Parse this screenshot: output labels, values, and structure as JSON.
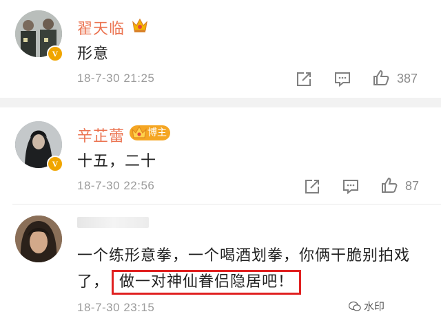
{
  "comments": [
    {
      "username": "翟天临",
      "text": "形意",
      "time": "18-7-30 21:25",
      "likes": "387",
      "verified_badge": "V",
      "badge_icon": "crown-icon"
    },
    {
      "username": "辛芷蕾",
      "tag": "博主",
      "text": "十五，二十",
      "time": "18-7-30 22:56",
      "likes": "87",
      "verified_badge": "V",
      "badge_icon": "crown-icon"
    },
    {
      "username_blurred": true,
      "text_part1": "一个练形意拳，一个喝酒划拳，你俩干脆别拍戏了，",
      "text_highlight": "做一对神仙眷侣隐居吧！",
      "time": "18-7-30 23:15"
    }
  ],
  "watermark": "水印",
  "colors": {
    "username": "#eb7350",
    "highlight_border": "#e02020",
    "badge": "#f0a500",
    "time": "#9b9b9b"
  }
}
